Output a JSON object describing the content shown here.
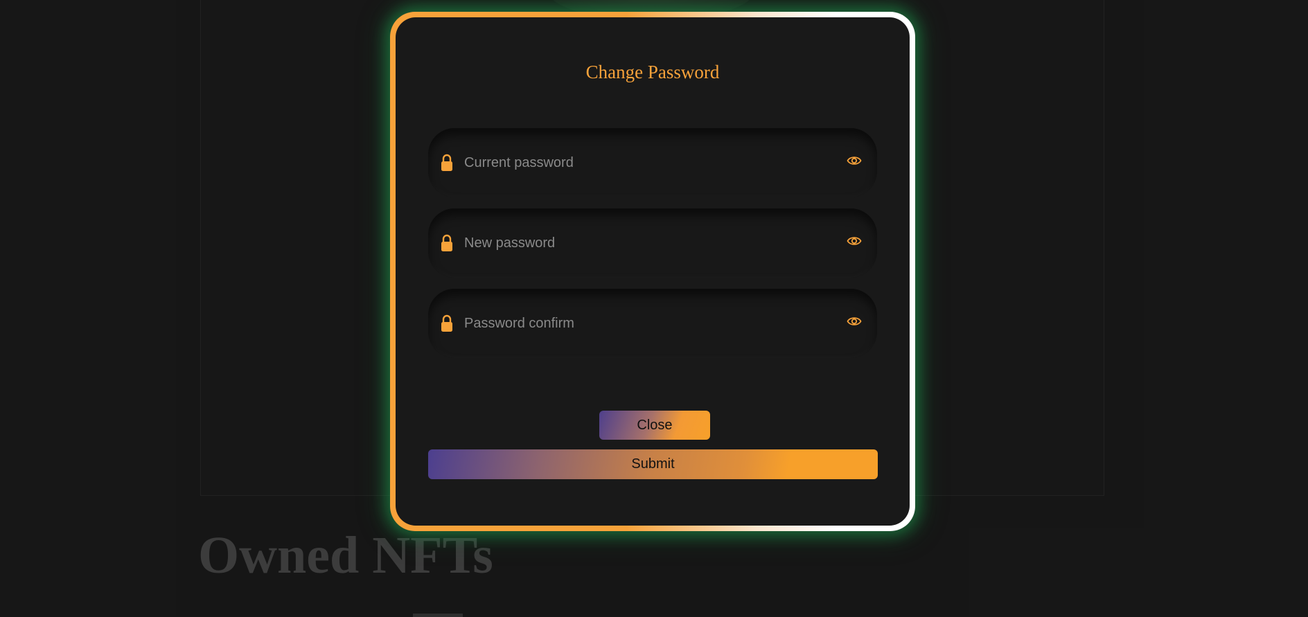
{
  "background": {
    "heading": "Owned NFTs"
  },
  "modal": {
    "title": "Change Password",
    "fields": [
      {
        "placeholder": "Current password",
        "value": "",
        "icon": "lock-icon",
        "toggle_icon": "eye-icon"
      },
      {
        "placeholder": "New password",
        "value": "",
        "icon": "lock-icon",
        "toggle_icon": "eye-icon"
      },
      {
        "placeholder": "Password confirm",
        "value": "",
        "icon": "lock-icon",
        "toggle_icon": "eye-icon"
      }
    ],
    "close_label": "Close",
    "submit_label": "Submit"
  },
  "colors": {
    "accent": "#f7a23a",
    "gradient_start": "#4c3f8f",
    "modal_background": "#191919",
    "glow": "#1ea050"
  }
}
